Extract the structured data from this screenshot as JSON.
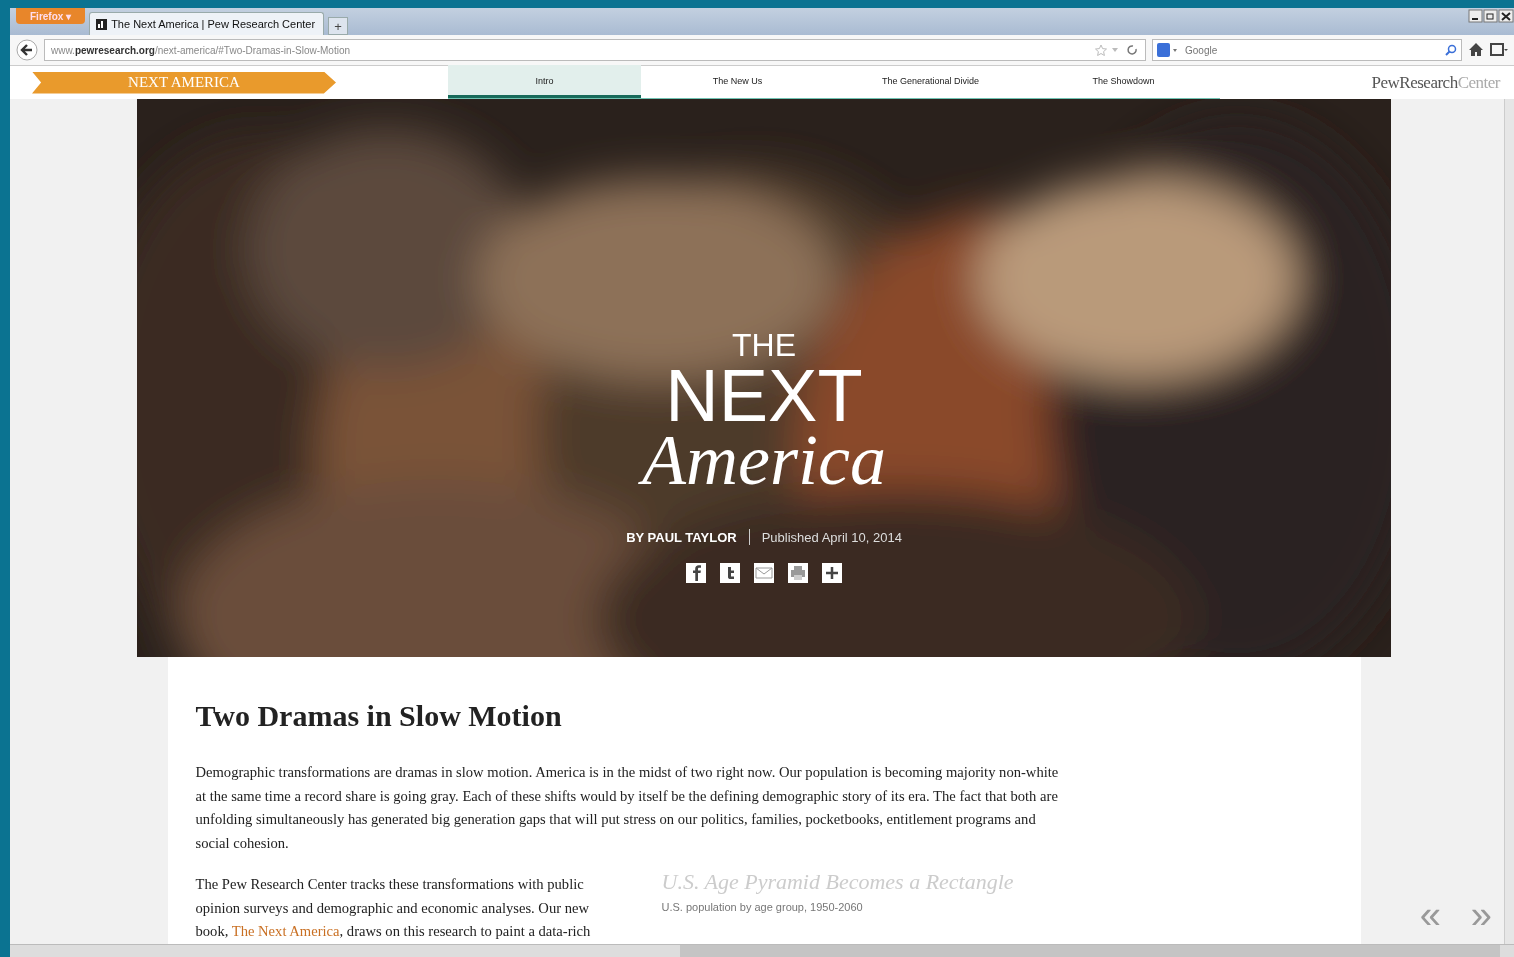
{
  "browser": {
    "menu_button": "Firefox ▾",
    "tabs": [
      {
        "title": "The Next America | Pew Research Center",
        "selected": true
      }
    ],
    "new_tab": "+",
    "address": "www.**pewresearch.org**/next-america/#Two-Dramas-in-Slow-Motion",
    "search": {
      "placeholder": "Google"
    }
  },
  "site": {
    "banner": "NEXT AMERICA",
    "nav": [
      {
        "label": "Intro",
        "selected": true
      },
      {
        "label": "The New Us",
        "selected": false
      },
      {
        "label": "The Generational Divide",
        "selected": false
      },
      {
        "label": "The Showdown",
        "selected": false
      }
    ],
    "logo_main": "PewResearch",
    "logo_tail": "Center"
  },
  "hero": {
    "kind": "picture",
    "title_small": "THE",
    "title_big": "NEXT",
    "title_script": "America",
    "byline": "BY PAUL TAYLOR",
    "published": "Published April 10, 2014"
  },
  "article": {
    "heading": "Two Dramas in Slow Motion",
    "paragraph_1": "Demographic transformations are dramas in slow motion. America is in the midst of two right now. Our population is becoming majority non-white at the same time a record share is going gray. Each of these shifts would by itself be the defining demographic story of its era. The fact that both are unfolding simultaneously has generated big generation gaps that will put stress on our politics, families, pocketbooks, entitlement programs and social cohesion.",
    "paragraph_2_before": "The Pew Research Center tracks these transformations with public opinion surveys and demographic and economic analyses. Our new book, ",
    "paragraph_2_link": "The Next America",
    "paragraph_2_after": ", draws on this research to paint a data-rich",
    "figure_title": "U.S. Age Pyramid Becomes a Rectangle",
    "figure_subtitle": "U.S. population by age group, 1950-2060"
  },
  "pager": {
    "previous": "«",
    "next": "»"
  }
}
